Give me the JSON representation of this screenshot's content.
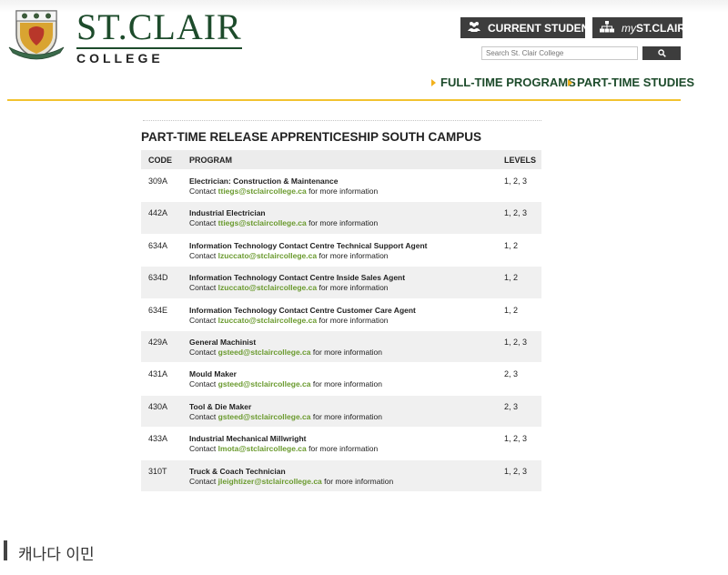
{
  "header": {
    "brand_main": "ST.CLAIR",
    "brand_sub": "COLLEGE",
    "current_students": "CURRENT STUDENTS",
    "my_prefix": "my",
    "my_suffix": "ST.CLAIR",
    "search_placeholder": "Search St. Clair College"
  },
  "nav": {
    "full_time": "FULL-TIME PROGRAMS",
    "part_time": "PART-TIME STUDIES"
  },
  "section": {
    "title": "PART-TIME RELEASE APPRENTICESHIP SOUTH CAMPUS"
  },
  "table": {
    "headers": {
      "code": "CODE",
      "program": "PROGRAM",
      "levels": "LEVELS"
    },
    "rows": [
      {
        "code": "309A",
        "name": "Electrician: Construction & Maintenance",
        "contact_prefix": "Contact ",
        "email": "ttiegs@stclaircollege.ca",
        "contact_suffix": " for more information",
        "levels": "1, 2, 3"
      },
      {
        "code": "442A",
        "name": "Industrial Electrician",
        "contact_prefix": "Contact ",
        "email": "ttiegs@stclaircollege.ca",
        "contact_suffix": " for more information",
        "levels": "1, 2, 3"
      },
      {
        "code": "634A",
        "name": "Information Technology Contact Centre Technical Support Agent",
        "contact_prefix": "Contact ",
        "email": "lzuccato@stclaircollege.ca",
        "contact_suffix": " for more information",
        "levels": "1, 2"
      },
      {
        "code": "634D",
        "name": "Information Technology Contact Centre Inside Sales Agent",
        "contact_prefix": "Contact ",
        "email": "lzuccato@stclaircollege.ca",
        "contact_suffix": " for more information",
        "levels": "1, 2"
      },
      {
        "code": "634E",
        "name": "Information Technology Contact Centre Customer Care Agent",
        "contact_prefix": "Contact ",
        "email": "lzuccato@stclaircollege.ca",
        "contact_suffix": " for more information",
        "levels": "1, 2"
      },
      {
        "code": "429A",
        "name": "General Machinist",
        "contact_prefix": "Contact ",
        "email": "gsteed@stclaircollege.ca",
        "contact_suffix": " for more information",
        "levels": "1, 2, 3"
      },
      {
        "code": "431A",
        "name": "Mould Maker",
        "contact_prefix": "Contact ",
        "email": "gsteed@stclaircollege.ca",
        "contact_suffix": " for more information",
        "levels": "2, 3"
      },
      {
        "code": "430A",
        "name": "Tool & Die Maker",
        "contact_prefix": "Contact ",
        "email": "gsteed@stclaircollege.ca",
        "contact_suffix": " for more information",
        "levels": "2, 3"
      },
      {
        "code": "433A",
        "name": "Industrial Mechanical Millwright",
        "contact_prefix": "Contact ",
        "email": "lmota@stclaircollege.ca",
        "contact_suffix": " for more information",
        "levels": "1, 2, 3"
      },
      {
        "code": "310T",
        "name": "Truck & Coach Technician",
        "contact_prefix": "Contact ",
        "email": "jleightizer@stclaircollege.ca",
        "contact_suffix": " for more information",
        "levels": "1, 2, 3"
      }
    ]
  },
  "footer": {
    "text": "캐나다 이민"
  },
  "colors": {
    "brand_green": "#1d4b2b",
    "email_green": "#6a9a2e",
    "gold": "#f2c32f",
    "button_dark": "#3d3d3d"
  },
  "icons": {
    "crest": "college-crest-icon",
    "students": "students-icon",
    "org": "sitemap-icon",
    "search": "search-icon",
    "arrow": "arrow-right-icon"
  }
}
